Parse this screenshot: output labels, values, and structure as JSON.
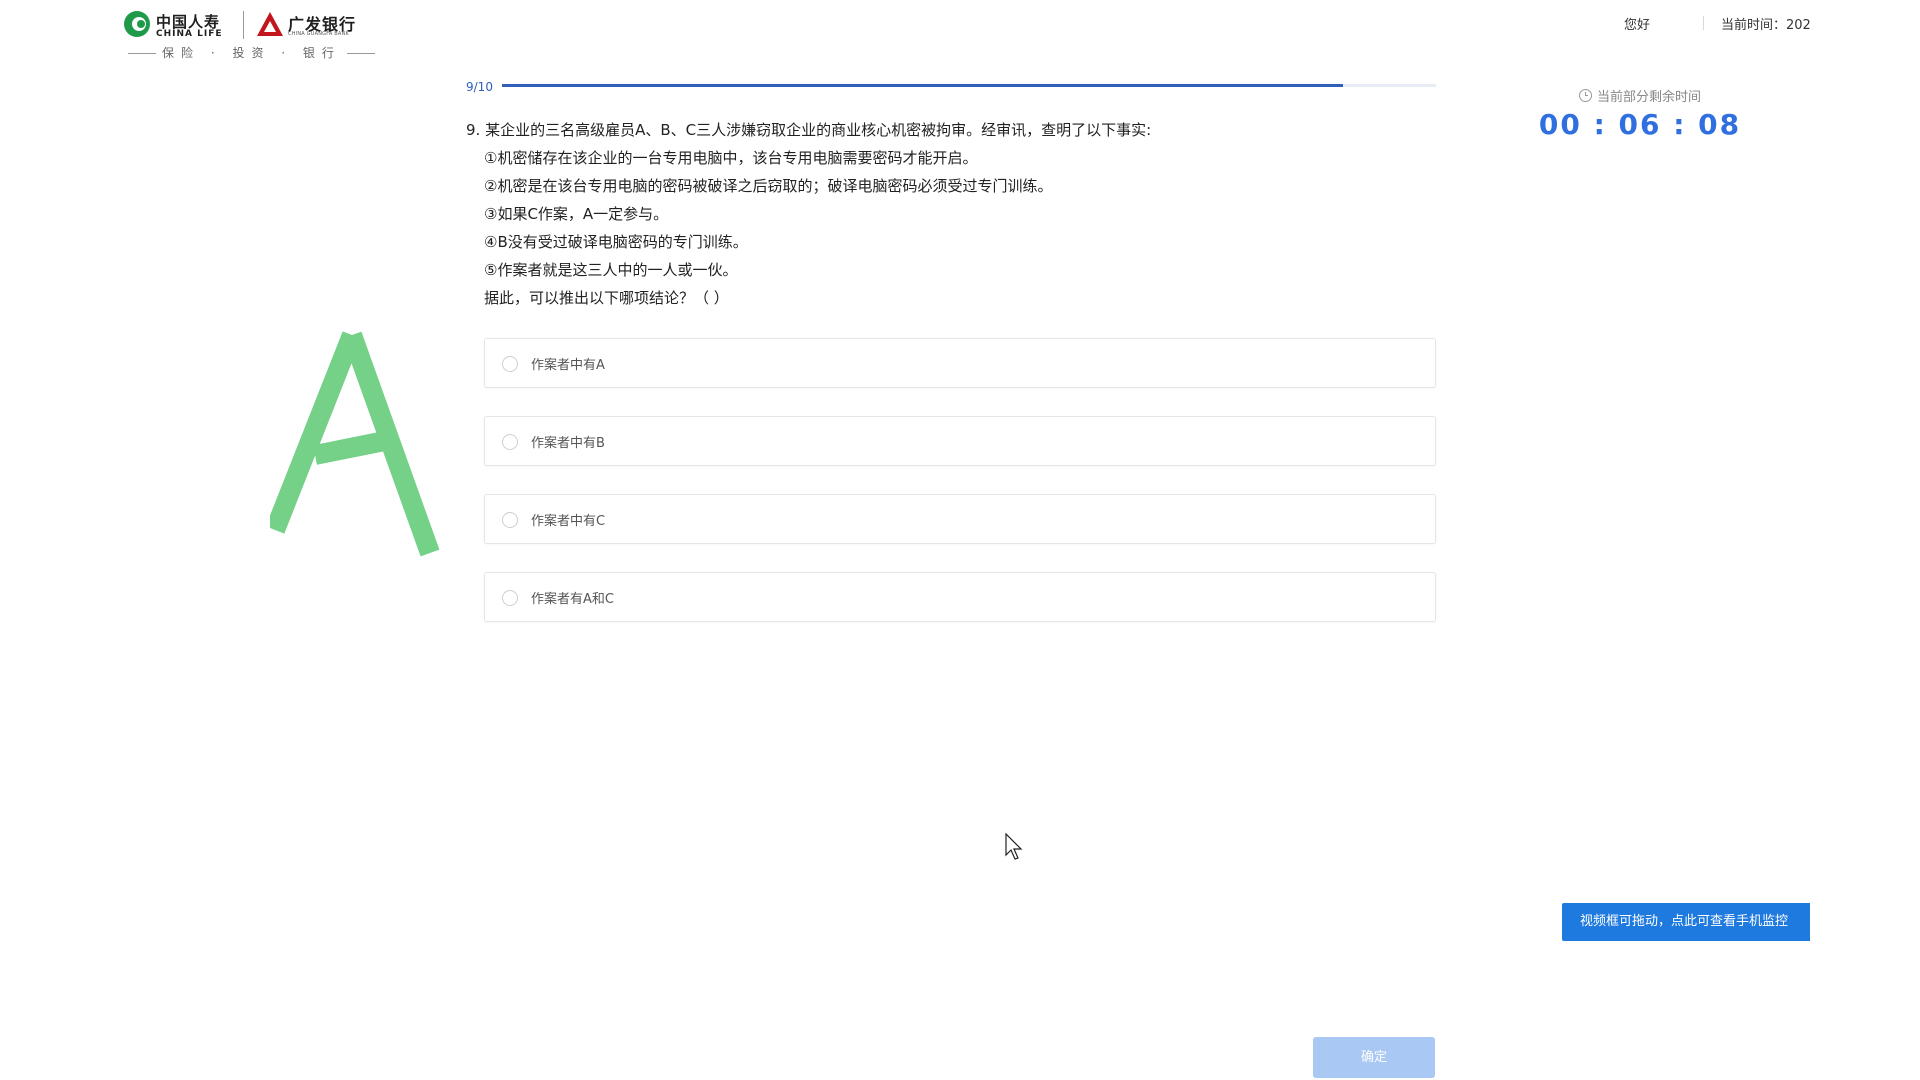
{
  "header": {
    "brand_left_cn": "中国人寿",
    "brand_left_en": "CHINA LIFE",
    "brand_right_cn": "广发银行",
    "brand_right_en": "CHINA GUANGFA BANK",
    "slogan": "保险 · 投资 · 银行",
    "greeting": "您好",
    "current_time_label": "当前时间：202"
  },
  "progress": {
    "text": "9/10",
    "fraction": 0.9
  },
  "question": {
    "stem": "9. 某企业的三名高级雇员A、B、C三人涉嫌窃取企业的商业核心机密被拘审。经审讯，查明了以下事实:",
    "conditions": [
      "①机密储存在该企业的一台专用电脑中，该台专用电脑需要密码才能开启。",
      "②机密是在该台专用电脑的密码被破译之后窃取的；破译电脑密码必须受过专门训练。",
      "③如果C作案，A一定参与。",
      "④B没有受过破译电脑密码的专门训练。",
      "⑤作案者就是这三人中的一人或一伙。"
    ],
    "prompt": "据此，可以推出以下哪项结论？（ ）",
    "options": [
      "作案者中有A",
      "作案者中有B",
      "作案者中有C",
      "作案者有A和C"
    ]
  },
  "timer": {
    "label": "当前部分剩余时间",
    "value": "00 : 06 : 08"
  },
  "video_tip": "视频框可拖动，点此可查看手机监控",
  "confirm_label": "确定",
  "colors": {
    "accent": "#2f6fe0",
    "progress": "#2f5fb8",
    "tip_bg": "#1f7ae0",
    "confirm_disabled": "#a9c8f3",
    "handwriting": "#5cc973"
  },
  "icons": [
    "china-life-logo-icon",
    "cgb-logo-icon",
    "clock-icon",
    "mouse-cursor-icon"
  ]
}
